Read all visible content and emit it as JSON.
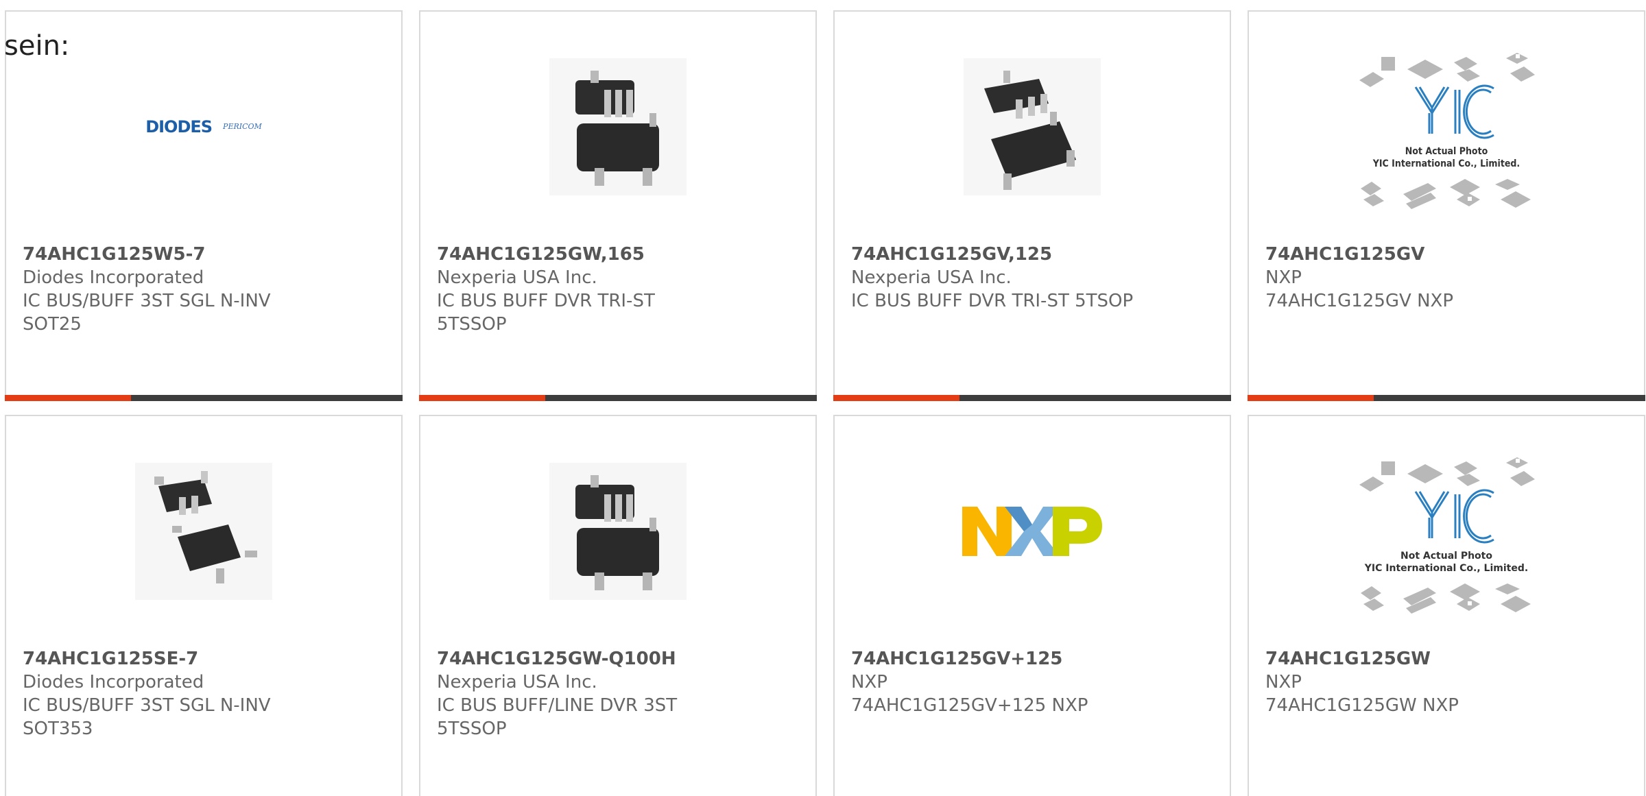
{
  "intro_text": "sein:",
  "colors": {
    "accent_bar": "#e43d16",
    "bar_dark": "#3d3d3d",
    "card_border": "#d9d9d9",
    "text_muted": "#666666",
    "diodes_blue": "#1c5fa8",
    "yic_blue": "#2a7fc1",
    "nxp_yellow": "#f9b500",
    "nxp_blue": "#7bb1db",
    "nxp_green": "#c9d200"
  },
  "products": [
    {
      "part_number": "74AHC1G125W5-7",
      "manufacturer": "Diodes Incorporated",
      "desc1": "IC BUS/BUFF 3ST SGL N-INV",
      "desc2": "SOT25",
      "image": "diodes-pericom-logo",
      "logo_text": "DIODES",
      "logo_sub": "PERICOM"
    },
    {
      "part_number": "74AHC1G125GW,165",
      "manufacturer": "Nexperia USA Inc.",
      "desc1": "IC BUS BUFF DVR TRI-ST",
      "desc2": "5TSSOP",
      "image": "sot-package-photo"
    },
    {
      "part_number": "74AHC1G125GV,125",
      "manufacturer": "Nexperia USA Inc.",
      "desc1": "IC BUS BUFF DVR TRI-ST 5TSOP",
      "desc2": "",
      "image": "sot-package-photo"
    },
    {
      "part_number": "74AHC1G125GV",
      "manufacturer": "NXP",
      "desc1": "74AHC1G125GV NXP",
      "desc2": "",
      "image": "yic-placeholder",
      "placeholder_line1": "Not Actual Photo",
      "placeholder_line2": "YIC International Co., Limited."
    },
    {
      "part_number": "74AHC1G125SE-7",
      "manufacturer": "Diodes Incorporated",
      "desc1": "IC BUS/BUFF 3ST SGL N-INV",
      "desc2": "SOT353",
      "image": "sot-package-photo"
    },
    {
      "part_number": "74AHC1G125GW-Q100H",
      "manufacturer": "Nexperia USA Inc.",
      "desc1": "IC BUS BUFF/LINE DVR 3ST",
      "desc2": "5TSSOP",
      "image": "sot-package-photo"
    },
    {
      "part_number": "74AHC1G125GV+125",
      "manufacturer": "NXP",
      "desc1": "74AHC1G125GV+125 NXP",
      "desc2": "",
      "image": "nxp-logo"
    },
    {
      "part_number": "74AHC1G125GW",
      "manufacturer": "NXP",
      "desc1": "74AHC1G125GW NXP",
      "desc2": "",
      "image": "yic-placeholder",
      "placeholder_line1": "Not Actual Photo",
      "placeholder_line2": "YIC International Co., Limited."
    }
  ]
}
